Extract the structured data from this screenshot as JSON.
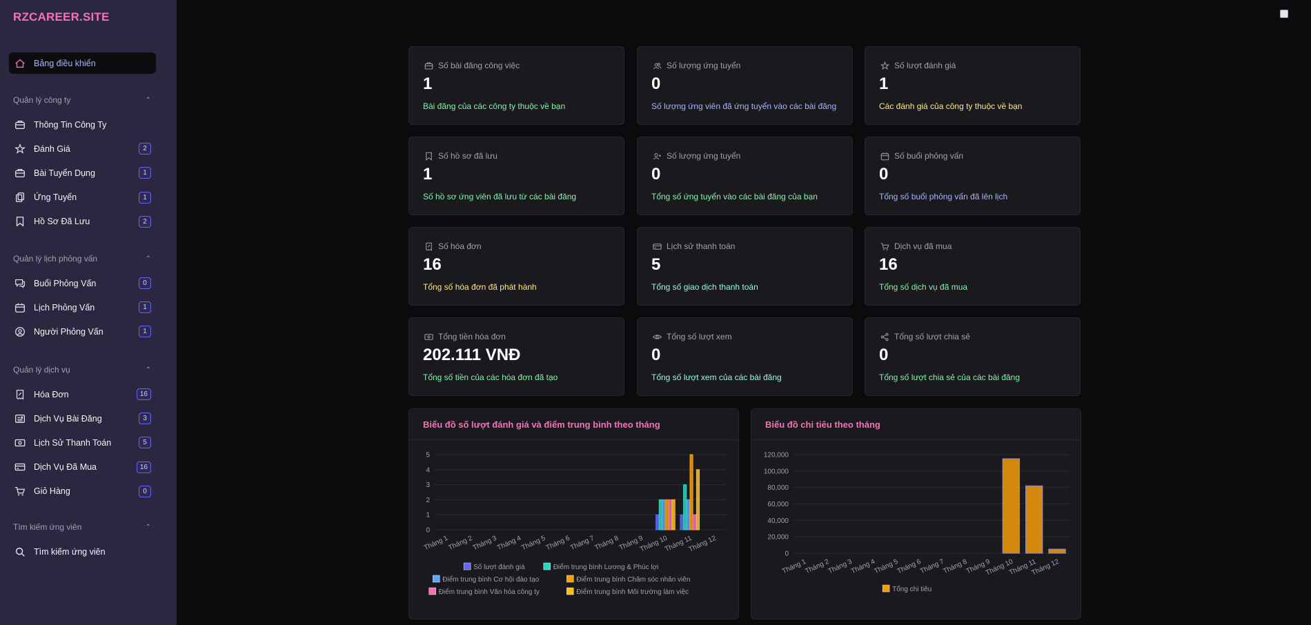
{
  "brand": "RZCAREER.SITE",
  "nav": {
    "dashboard": {
      "label": "Bảng điều khiển",
      "icon": "home-icon"
    },
    "sections": [
      {
        "title": "Quản lý công ty",
        "items": [
          {
            "label": "Thông Tin Công Ty",
            "icon": "briefcase-icon",
            "badge": ""
          },
          {
            "label": "Đánh Giá",
            "icon": "star-icon",
            "badge": "2"
          },
          {
            "label": "Bài Tuyển Dụng",
            "icon": "briefcase-icon",
            "badge": "1"
          },
          {
            "label": "Ứng Tuyển",
            "icon": "copy-icon",
            "badge": "1"
          },
          {
            "label": "Hồ Sơ Đã Lưu",
            "icon": "bookmark-icon",
            "badge": "2"
          }
        ]
      },
      {
        "title": "Quản lý lịch phỏng vấn",
        "items": [
          {
            "label": "Buổi Phỏng Vấn",
            "icon": "chat-icon",
            "badge": "0"
          },
          {
            "label": "Lịch Phỏng Vấn",
            "icon": "calendar-icon",
            "badge": "1"
          },
          {
            "label": "Người Phỏng Vấn",
            "icon": "user-circle-icon",
            "badge": "1"
          }
        ]
      },
      {
        "title": "Quản lý dịch vụ",
        "items": [
          {
            "label": "Hóa Đơn",
            "icon": "receipt-icon",
            "badge": "16"
          },
          {
            "label": "Dịch Vụ Bài Đăng",
            "icon": "newspaper-icon",
            "badge": "3"
          },
          {
            "label": "Lịch Sử Thanh Toán",
            "icon": "banknote-icon",
            "badge": "5"
          },
          {
            "label": "Dịch Vụ Đã Mua",
            "icon": "credit-card-icon",
            "badge": "16"
          },
          {
            "label": "Giỏ Hàng",
            "icon": "cart-icon",
            "badge": "0"
          }
        ]
      },
      {
        "title": "Tìm kiếm ứng viên",
        "items": [
          {
            "label": "Tìm kiếm ứng viên",
            "icon": "search-icon",
            "badge": ""
          }
        ]
      }
    ]
  },
  "cards": [
    {
      "title": "Số bài đăng công việc",
      "value": "1",
      "desc": "Bài đăng của các công ty thuộc về bạn",
      "icon": "briefcase-icon",
      "color": "#86efac"
    },
    {
      "title": "Số lượng ứng tuyển",
      "value": "0",
      "desc": "Số lượng ứng viên đã ứng tuyển vào các bài đăng",
      "icon": "users-icon",
      "color": "#a5b4fc"
    },
    {
      "title": "Số lượt đánh giá",
      "value": "1",
      "desc": "Các đánh giá của công ty thuộc về bạn",
      "icon": "star-icon",
      "color": "#fde68a"
    },
    {
      "title": "Số hồ sơ đã lưu",
      "value": "1",
      "desc": "Số hồ sơ ứng viên đã lưu từ các bài đăng",
      "icon": "bookmark-icon",
      "color": "#86efac"
    },
    {
      "title": "Số lượng ứng tuyển",
      "value": "0",
      "desc": "Tổng số ứng tuyển vào các bài đăng của bạn",
      "icon": "user-plus-icon",
      "color": "#86efac"
    },
    {
      "title": "Số buổi phỏng vấn",
      "value": "0",
      "desc": "Tổng số buổi phỏng vấn đã lên lịch",
      "icon": "calendar-icon",
      "color": "#a5b4fc"
    },
    {
      "title": "Số hóa đơn",
      "value": "16",
      "desc": "Tổng số hóa đơn đã phát hành",
      "icon": "receipt-icon",
      "color": "#fde68a"
    },
    {
      "title": "Lịch sử thanh toán",
      "value": "5",
      "desc": "Tổng số giao dịch thanh toán",
      "icon": "credit-card-icon",
      "color": "#99f6e4"
    },
    {
      "title": "Dịch vụ đã mua",
      "value": "16",
      "desc": "Tổng số dịch vụ đã mua",
      "icon": "cart-icon",
      "color": "#86efac"
    },
    {
      "title": "Tổng tiền hóa đơn",
      "value": "202.111 VNĐ",
      "desc": "Tổng số tiền của các hóa đơn đã tạo",
      "icon": "banknote-icon",
      "color": "#86efac"
    },
    {
      "title": "Tổng số lượt xem",
      "value": "0",
      "desc": "Tổng số lượt xem của các bài đăng",
      "icon": "eye-icon",
      "color": "#99f6e4"
    },
    {
      "title": "Tổng số lượt chia sẻ",
      "value": "0",
      "desc": "Tổng số lượt chia sẻ của các bài đăng",
      "icon": "share-icon",
      "color": "#86efac"
    }
  ],
  "panels": {
    "reviews_title": "Biểu đồ số lượt đánh giá và điểm trung bình theo tháng",
    "spend_title": "Biểu đồ chi tiêu theo tháng"
  },
  "chart_data": [
    {
      "type": "bar",
      "title": "Biểu đồ số lượt đánh giá và điểm trung bình theo tháng",
      "categories": [
        "Tháng 1",
        "Tháng 2",
        "Tháng 3",
        "Tháng 4",
        "Tháng 5",
        "Tháng 6",
        "Tháng 7",
        "Tháng 8",
        "Tháng 9",
        "Tháng 10",
        "Tháng 11",
        "Tháng 12"
      ],
      "ylim": [
        0,
        5
      ],
      "yticks": [
        0,
        1,
        2,
        3,
        4,
        5
      ],
      "grid": true,
      "legend": "bottom",
      "series": [
        {
          "name": "Số lượt đánh giá",
          "color": "#6366f1",
          "values": [
            0,
            0,
            0,
            0,
            0,
            0,
            0,
            0,
            0,
            1,
            1,
            0
          ]
        },
        {
          "name": "Điểm trung bình Lương & Phúc lợi",
          "color": "#2dd4bf",
          "values": [
            0,
            0,
            0,
            0,
            0,
            0,
            0,
            0,
            0,
            2,
            3,
            0
          ]
        },
        {
          "name": "Điểm trung bình Cơ hội đào tạo",
          "color": "#60a5fa",
          "values": [
            0,
            0,
            0,
            0,
            0,
            0,
            0,
            0,
            0,
            2,
            2,
            0
          ]
        },
        {
          "name": "Điểm trung bình Chăm sóc nhân viên",
          "color": "#f59e0b",
          "values": [
            0,
            0,
            0,
            0,
            0,
            0,
            0,
            0,
            0,
            2,
            5,
            0
          ]
        },
        {
          "name": "Điểm trung bình Văn hóa công ty",
          "color": "#f472b6",
          "values": [
            0,
            0,
            0,
            0,
            0,
            0,
            0,
            0,
            0,
            2,
            1,
            0
          ]
        },
        {
          "name": "Điểm trung bình Môi trường làm việc",
          "color": "#fbbf24",
          "values": [
            0,
            0,
            0,
            0,
            0,
            0,
            0,
            0,
            0,
            2,
            4,
            0
          ]
        }
      ]
    },
    {
      "type": "bar",
      "title": "Biểu đồ chi tiêu theo tháng",
      "categories": [
        "Tháng 1",
        "Tháng 2",
        "Tháng 3",
        "Tháng 4",
        "Tháng 5",
        "Tháng 6",
        "Tháng 7",
        "Tháng 8",
        "Tháng 9",
        "Tháng 10",
        "Tháng 11",
        "Tháng 12"
      ],
      "ylim": [
        0,
        120000
      ],
      "yticks": [
        0,
        20000,
        40000,
        60000,
        80000,
        100000,
        120000
      ],
      "grid": true,
      "legend": "bottom",
      "series": [
        {
          "name": "Tổng chi tiêu",
          "color": "#f59e0b",
          "values": [
            0,
            0,
            0,
            0,
            0,
            0,
            0,
            0,
            0,
            115000,
            82000,
            5000
          ]
        }
      ]
    }
  ]
}
